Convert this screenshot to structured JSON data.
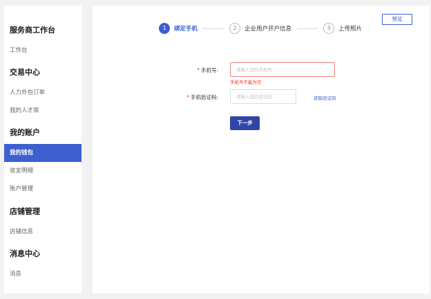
{
  "sidebar": {
    "sections": [
      {
        "title": "服务商工作台",
        "items": [
          {
            "label": "工作台"
          }
        ]
      },
      {
        "title": "交易中心",
        "items": [
          {
            "label": "人力外包订单"
          },
          {
            "label": "我的人才库"
          }
        ]
      },
      {
        "title": "我的账户",
        "items": [
          {
            "label": "我的钱包",
            "active": true
          },
          {
            "label": "收支明细"
          },
          {
            "label": "账户管理"
          }
        ]
      },
      {
        "title": "店铺管理",
        "items": [
          {
            "label": "店铺信息"
          }
        ]
      },
      {
        "title": "消息中心",
        "items": [
          {
            "label": "消息"
          }
        ]
      }
    ]
  },
  "main": {
    "preview_label": "预览",
    "steps": [
      {
        "num": "1",
        "label": "绑定手机",
        "active": true
      },
      {
        "num": "2",
        "label": "企业用户开户信息",
        "active": false
      },
      {
        "num": "3",
        "label": "上传照片",
        "active": false
      }
    ],
    "form": {
      "phone": {
        "required_mark": "*",
        "label": "手机号:",
        "placeholder": "请输入您的手机号",
        "error": "手机号不能为空"
      },
      "code": {
        "required_mark": "*",
        "label": "手机验证码:",
        "placeholder": "请输入短信验证码",
        "get_code_label": "获取验证码"
      },
      "next_label": "下一步"
    }
  },
  "colors": {
    "accent": "#3d5fcf",
    "button": "#2f46a8",
    "error": "#e33333"
  }
}
